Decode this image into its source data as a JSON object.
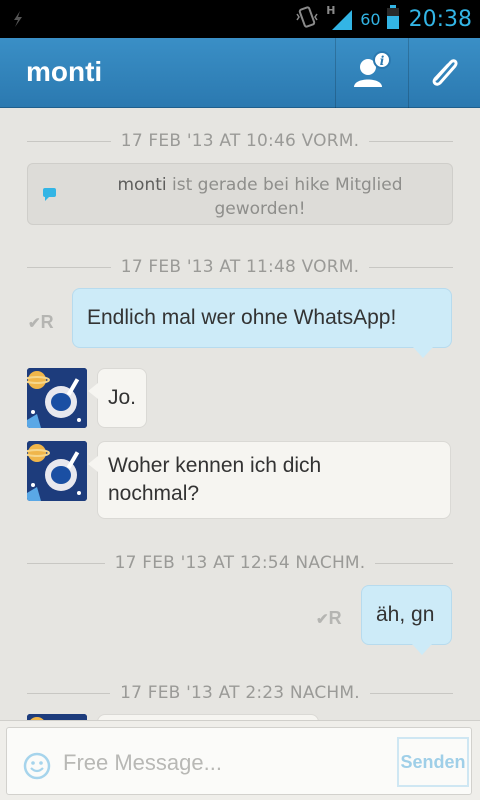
{
  "status_bar": {
    "network_label": "H",
    "battery": "60",
    "time": "20:38",
    "icons": [
      "usb-icon",
      "vibrate-icon",
      "signal-icon",
      "battery-icon"
    ]
  },
  "action_bar": {
    "title": "monti",
    "icons": [
      "contact-info-icon",
      "paperclip-icon"
    ]
  },
  "chat": {
    "dividers": [
      "17 FEB '13 AT 10:46 VORM.",
      "17 FEB '13 AT 11:48 VORM.",
      "17 FEB '13 AT 12:54 NACHM.",
      "17 FEB '13 AT 2:23 NACHM."
    ],
    "system_message": {
      "name": "monti",
      "text": " ist gerade bei hike Mitglied geworden!"
    },
    "messages": [
      {
        "direction": "out",
        "text": "Endlich mal wer ohne WhatsApp!",
        "status": "R"
      },
      {
        "direction": "in",
        "text": "Jo."
      },
      {
        "direction": "in",
        "text": "Woher kennen ich dich nochmal?"
      },
      {
        "direction": "out",
        "text": "äh, gn",
        "status": "R"
      }
    ]
  },
  "compose": {
    "placeholder": "Free Message...",
    "send_label": "Senden"
  },
  "colors": {
    "accent": "#33b5e5",
    "action_bar": "#2f82b8",
    "outgoing_bubble": "#cdebf8",
    "incoming_bubble": "#f6f5f1"
  }
}
